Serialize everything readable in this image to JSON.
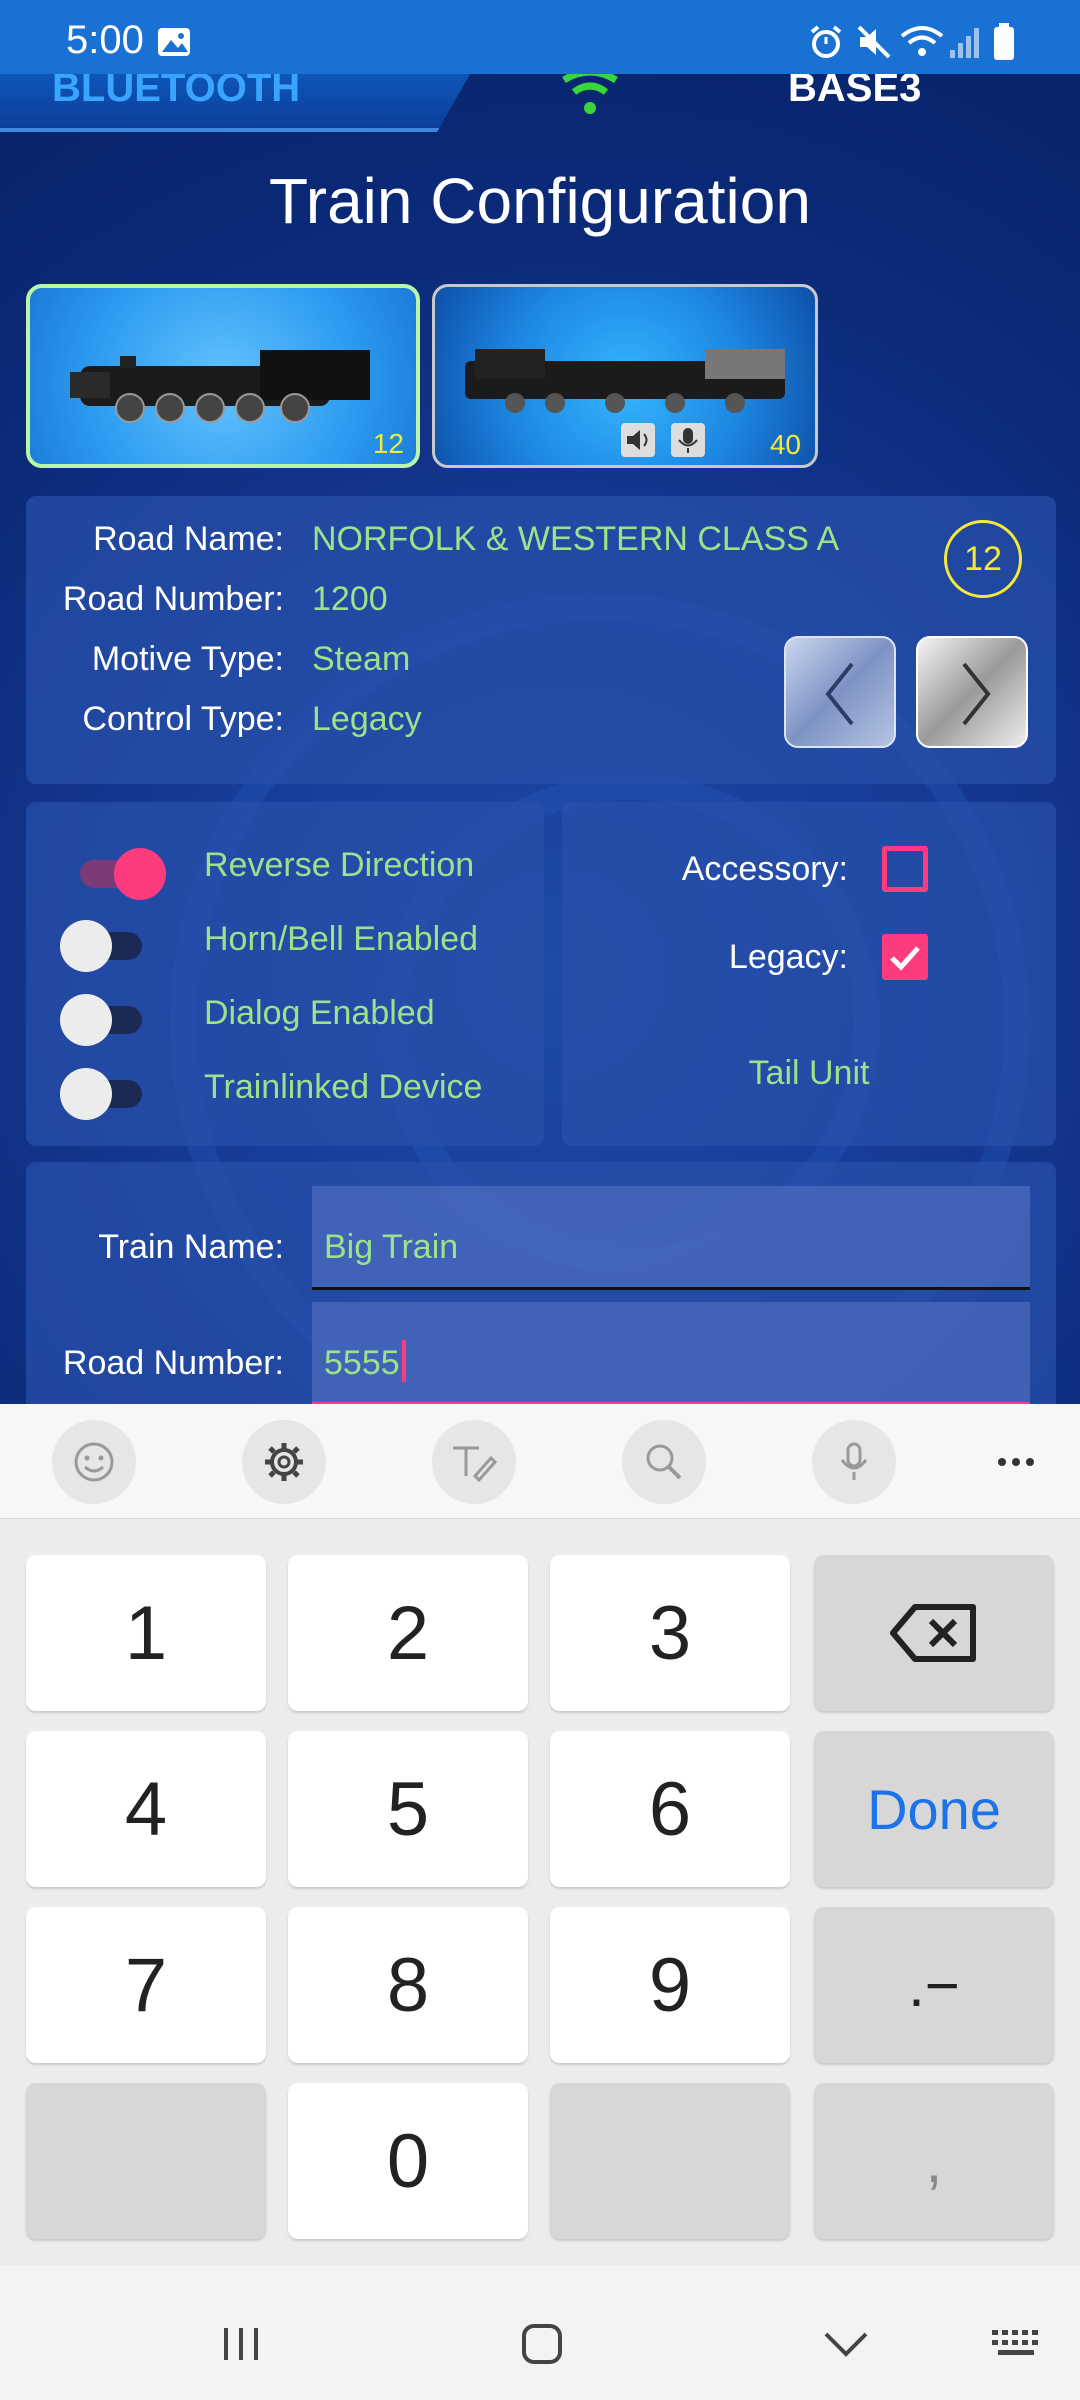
{
  "status_bar": {
    "time": "5:00"
  },
  "header": {
    "connection_tab": "BLUETOOTH",
    "base_label": "BASE3",
    "title": "Train Configuration"
  },
  "thumbnails": [
    {
      "number": "12"
    },
    {
      "number": "40"
    }
  ],
  "train_info": {
    "badge": "12",
    "rows": [
      {
        "label": "Road Name:",
        "value": "NORFOLK & WESTERN CLASS A"
      },
      {
        "label": "Road Number:",
        "value": "1200"
      },
      {
        "label": "Motive Type:",
        "value": "Steam"
      },
      {
        "label": "Control Type:",
        "value": "Legacy"
      }
    ]
  },
  "toggles": [
    {
      "label": "Reverse Direction",
      "on": true
    },
    {
      "label": "Horn/Bell Enabled",
      "on": false
    },
    {
      "label": "Dialog Enabled",
      "on": false
    },
    {
      "label": "Trainlinked Device",
      "on": false
    }
  ],
  "options": {
    "accessory_label": "Accessory:",
    "accessory_checked": false,
    "legacy_label": "Legacy:",
    "legacy_checked": true,
    "tail_unit": "Tail Unit"
  },
  "form": {
    "train_name_label": "Train Name:",
    "train_name_value": "Big Train",
    "road_number_label": "Road Number:",
    "road_number_value": "5555"
  },
  "keyboard": {
    "keys": [
      "1",
      "2",
      "3",
      "4",
      "5",
      "6",
      "7",
      "8",
      "9",
      "0"
    ],
    "done_label": "Done",
    "punct_label": ".−",
    "comma_label": ","
  },
  "colors": {
    "accent_pink": "#ff3b7f",
    "value_green": "#9be38a",
    "badge_yellow": "#f4ea3a",
    "done_blue": "#1a73e8"
  }
}
